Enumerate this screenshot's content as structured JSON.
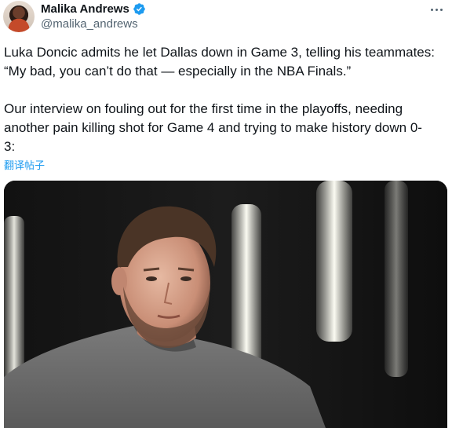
{
  "author": {
    "name": "Malika Andrews",
    "handle": "@malika_andrews",
    "verified": true,
    "avatar_icon": "avatar-photo-icon"
  },
  "post": {
    "paragraph1_line1": "Luka Doncic admits he let Dallas down in Game 3, telling his teammates:",
    "paragraph1_line2": "“My bad, you can’t do that — especially in the NBA Finals.”",
    "paragraph2_line1": "Our interview on fouling out for the first time in the playoffs, needing",
    "paragraph2_line2": "another pain killing shot for Game 4 and trying to make history down 0-",
    "paragraph2_line3": "3:",
    "translate_label": "翻译帖子"
  },
  "media": {
    "type": "video-still",
    "description_icon": "interview-photo"
  },
  "colors": {
    "text": "#0f1419",
    "secondary": "#536471",
    "link": "#1d9bf0",
    "verified": "#1d9bf0"
  }
}
